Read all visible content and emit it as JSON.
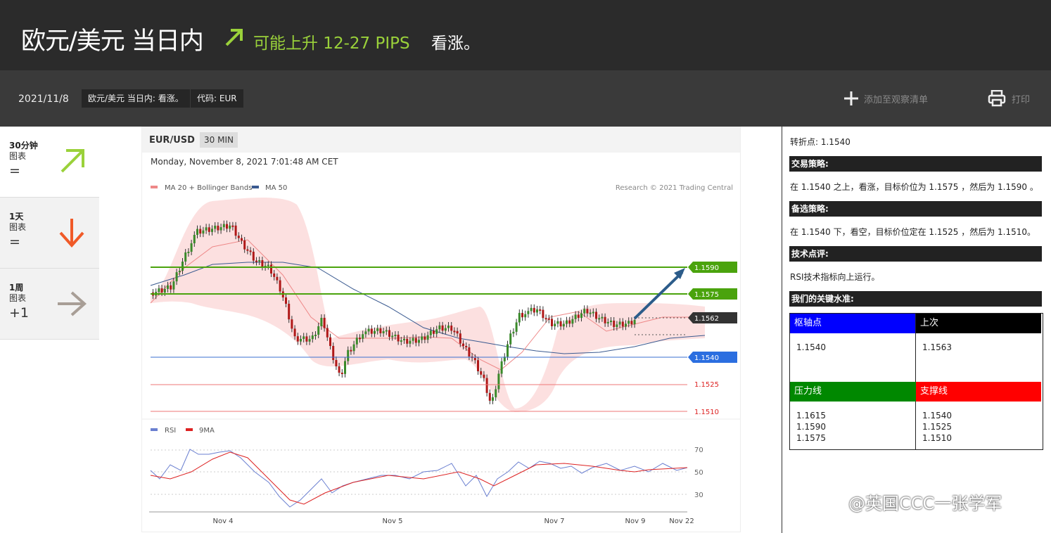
{
  "header": {
    "title": "欧元/美元 当日内",
    "forecast": "可能上升 12-27 PIPS",
    "bias": "看涨。"
  },
  "subbar": {
    "date": "2021/11/8",
    "tag1": "欧元/美元 当日内: 看涨。",
    "tag2": "代码: EUR",
    "watchlist": "添加至观察清单",
    "print": "打印"
  },
  "timeframes": [
    {
      "name": "30分钟",
      "chart": "图表",
      "value": "=",
      "icon": "arrow-up-right-icon",
      "color": "#9ad13a"
    },
    {
      "name": "1天",
      "chart": "图表",
      "value": "=",
      "icon": "arrow-down-icon",
      "color": "#f05a28"
    },
    {
      "name": "1周",
      "chart": "图表",
      "value": "+1",
      "icon": "arrow-right-icon",
      "color": "#a89e96"
    }
  ],
  "chart": {
    "symbol": "EUR/USD",
    "timeframe": "30 MIN",
    "timestamp": "Monday, November 8, 2021 7:01:48 AM CET",
    "legend1": "MA 20 + Bollinger Bands",
    "legend2": "MA 50",
    "credit": "Research © 2021 Trading Central",
    "rsi_legend1": "RSI",
    "rsi_legend2": "9MA",
    "levels": [
      "1.1590",
      "1.1575",
      "1.1562",
      "1.1540",
      "1.1525",
      "1.1510"
    ],
    "rsi_ticks": [
      "70",
      "50",
      "30"
    ],
    "xticks": [
      "Nov 4",
      "Nov 5",
      "Nov 7",
      "Nov 9",
      "Nov 22"
    ]
  },
  "panel": {
    "pivot_line": "转折点: 1.1540",
    "strategy_title": "交易策略:",
    "strategy": "在 1.1540 之上，看涨，目标价位为 1.1575 ，然后为 1.1590 。",
    "alt_title": "备选策略:",
    "alt": "在 1.1540 下，看空，目标价位定在 1.1525 ，然后为 1.1510。",
    "comment_title": "技术点评:",
    "comment": "RSI技术指标向上运行。",
    "levels_title": "我们的关键水准:",
    "pivot_h": "枢轴点",
    "pivot": "1.1540",
    "last_h": "上次",
    "last": "1.1563",
    "res_h": "压力线",
    "res": [
      "1.1615",
      "1.1590",
      "1.1575"
    ],
    "sup_h": "支撑线",
    "sup": [
      "1.1540",
      "1.1525",
      "1.1510"
    ]
  },
  "watermark": "@英国CCC一张学军"
}
